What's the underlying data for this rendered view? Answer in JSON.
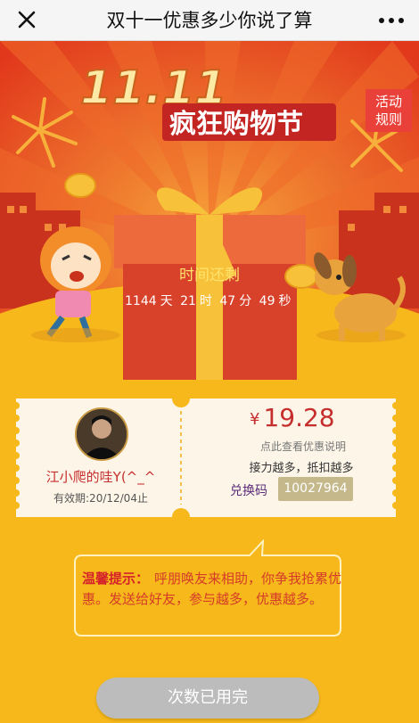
{
  "header": {
    "title": "双十一优惠多少你说了算"
  },
  "rules_button": {
    "line1": "活动",
    "line2": "规则"
  },
  "countdown": {
    "label": "时间还剩",
    "days": "1144",
    "days_unit": "天",
    "hours": "21",
    "hours_unit": "时",
    "minutes": "47",
    "minutes_unit": "分",
    "seconds": "49",
    "seconds_unit": "秒"
  },
  "ticket": {
    "username": "江小爬的哇Y(^_^",
    "validity": "有效期:20/12/04止",
    "currency": "¥",
    "amount": "19.28",
    "tip_link": "点此查看优惠说明",
    "more_tip": "接力越多，抵扣越多",
    "code_label": "兑换码",
    "code": "10027964"
  },
  "tip": {
    "label": "温馨提示：",
    "text": "呼朋唤友来相助，你争我抢累优惠。发送给好友，参与越多，优惠越多。"
  },
  "action_button": {
    "label": "次数已用完"
  },
  "colors": {
    "accent_red": "#e64a23",
    "page_yellow": "#f6b81a",
    "price_red": "#c62d2d"
  }
}
